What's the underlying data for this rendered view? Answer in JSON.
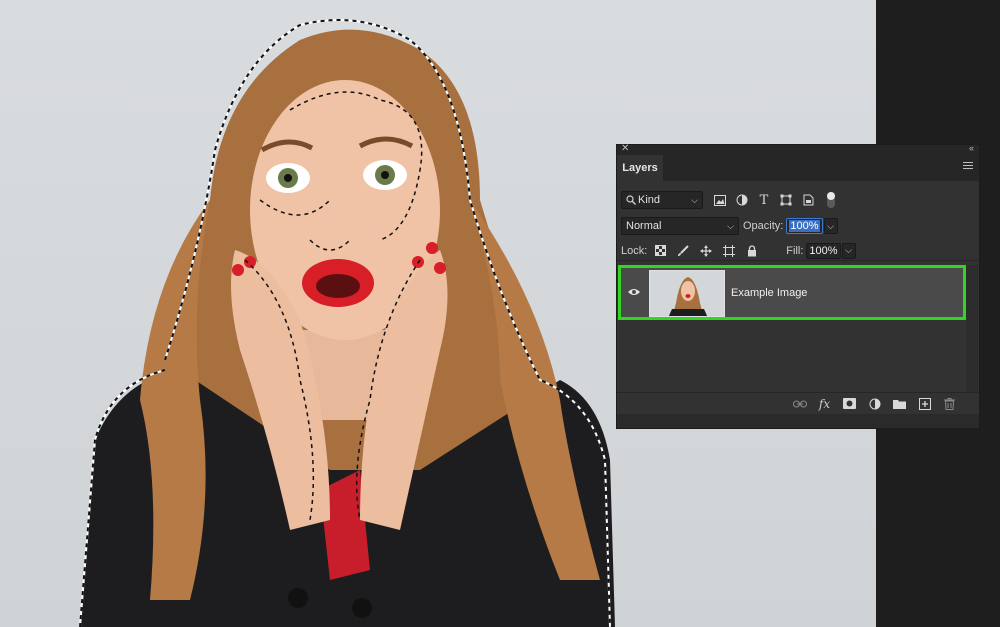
{
  "panel": {
    "title": "Layers",
    "filter_kind": "Kind",
    "blend_mode": "Normal",
    "opacity_label": "Opacity:",
    "opacity_value": "100%",
    "lock_label": "Lock:",
    "fill_label": "Fill:",
    "fill_value": "100%",
    "layers": [
      {
        "name": "Example Image",
        "visible": true,
        "selected": true
      }
    ]
  },
  "icons": {
    "close": "close-icon",
    "collapse": "collapse-icon",
    "menu": "panel-menu-icon",
    "filter_icons": [
      "image-filter-icon",
      "adjustment-filter-icon",
      "type-filter-icon",
      "shape-filter-icon",
      "smart-object-filter-icon"
    ],
    "lock_icons": [
      "lock-transparent-pixels-icon",
      "lock-image-pixels-icon",
      "lock-position-icon",
      "lock-artboard-icon",
      "lock-all-icon"
    ],
    "footer_icons": [
      "link-layers-icon",
      "layer-style-icon",
      "add-mask-icon",
      "new-adjustment-layer-icon",
      "new-group-icon",
      "new-layer-icon",
      "delete-layer-icon"
    ]
  },
  "colors": {
    "selection_highlight": "#31d61f",
    "panel_bg": "#323232",
    "focus_blue": "#3b7bd6"
  }
}
